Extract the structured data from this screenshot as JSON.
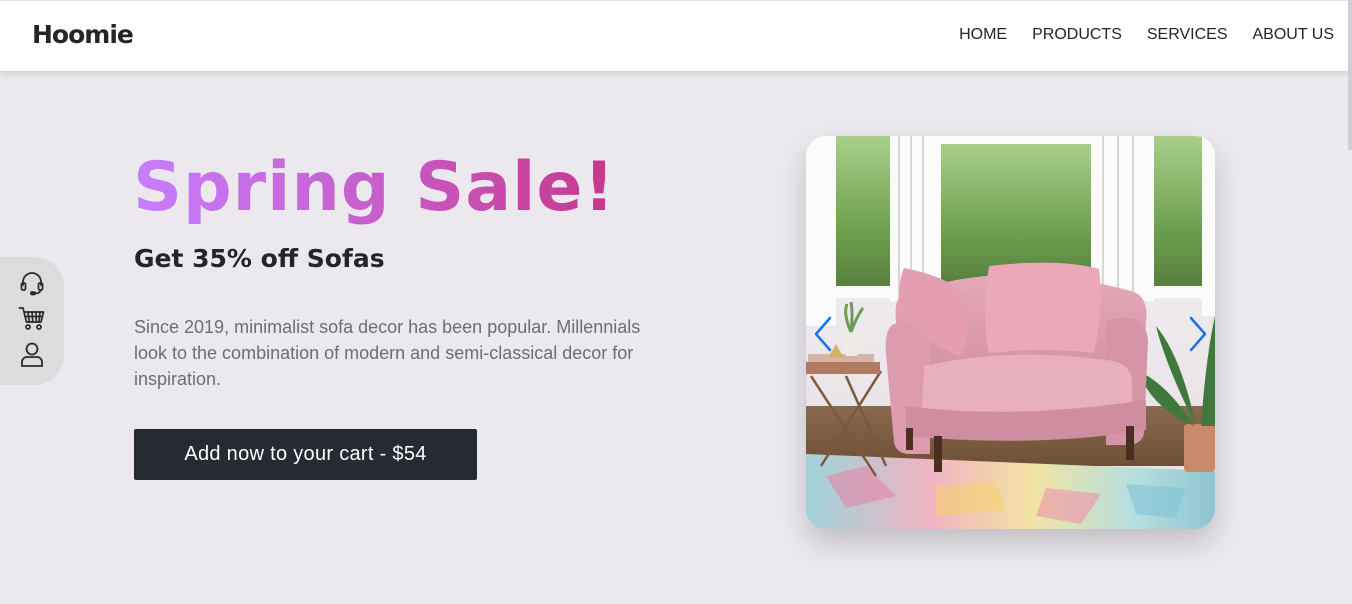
{
  "header": {
    "brand": "Hoomie",
    "nav": [
      {
        "label": "HOME"
      },
      {
        "label": "PRODUCTS"
      },
      {
        "label": "SERVICES"
      },
      {
        "label": "ABOUT US"
      }
    ]
  },
  "side_dock": {
    "icons": [
      "headset-icon",
      "cart-icon",
      "user-icon"
    ]
  },
  "hero": {
    "headline": "Spring Sale!",
    "subheadline": "Get 35% off Sofas",
    "description": "Since 2019, minimalist sofa decor has been popular. Millennials look to the combination of modern and semi-classical decor for inspiration.",
    "cta_label": "Add now to your cart - $54"
  },
  "carousel": {
    "prev_icon": "chevron-left-icon",
    "next_icon": "chevron-right-icon",
    "image": "pink-armchair-photo"
  },
  "colors": {
    "background": "#ebe8ee",
    "navbar": "#ffffff",
    "text_dark": "#232529",
    "text_muted": "#6d6d75",
    "cta_bg": "#262a33",
    "gradient_start": "#c77dff",
    "gradient_end": "#c8378a",
    "arrow": "#1a73e8"
  }
}
